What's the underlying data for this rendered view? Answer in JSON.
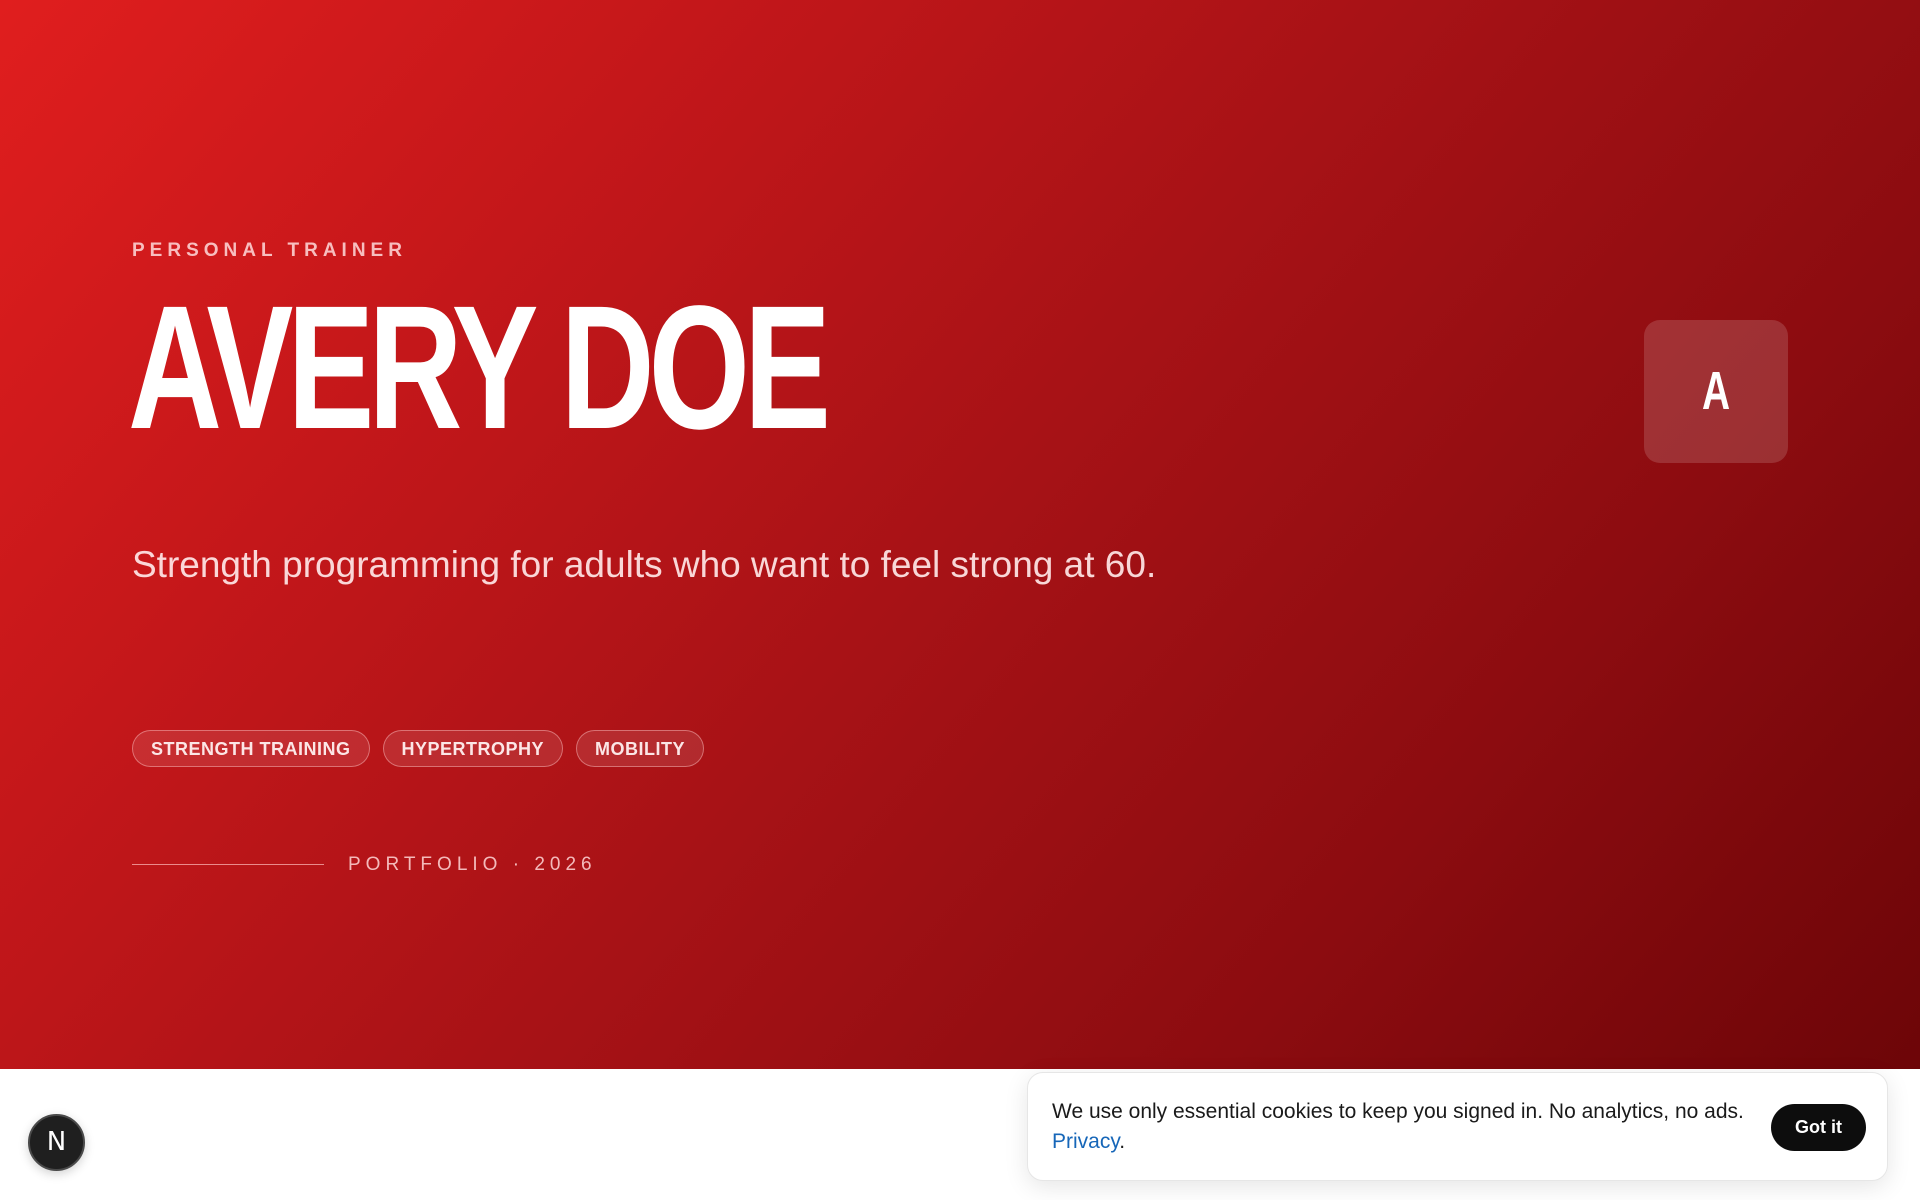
{
  "hero": {
    "eyebrow": "PERSONAL TRAINER",
    "name": "AVERY DOE",
    "tagline": "Strength programming for adults who want to feel strong at 60.",
    "tags": [
      "STRENGTH TRAINING",
      "HYPERTROPHY",
      "MOBILITY"
    ],
    "portfolio_label": "PORTFOLIO · 2026",
    "avatar_letter": "A"
  },
  "badge": {
    "letter": "N"
  },
  "cookie_banner": {
    "message": "We use only essential cookies to keep you signed in. No analytics, no ads.",
    "link_label": "Privacy",
    "trailing": ".",
    "button_label": "Got it"
  },
  "colors": {
    "hero_gradient_start": "#e01e1e",
    "hero_gradient_end": "#6d0508",
    "link": "#1666b8",
    "button": "#0d0d0d"
  },
  "icons": {
    "badge": "nextjs-badge-icon"
  }
}
